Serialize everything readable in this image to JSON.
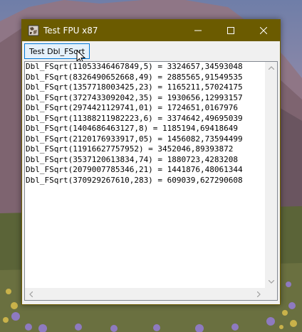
{
  "window": {
    "title": "Test FPU x87"
  },
  "toolbar": {
    "test_button_label": "Test Dbl_FSqrt"
  },
  "output": {
    "lines": [
      "Dbl_FSqrt(11053346467849,5) = 3324657,34593048",
      "Dbl_FSqrt(8326490652668,49) = 2885565,91549535",
      "Dbl_FSqrt(1357718003425,23) = 1165211,57024175",
      "Dbl_FSqrt(3727433092042,35) = 1930656,12993157",
      "Dbl_FSqrt(2974421129741,01) = 1724651,0167976",
      "Dbl_FSqrt(11388211982223,6) = 3374642,49695039",
      "Dbl_FSqrt(1404686463127,8) = 1185194,69418649",
      "Dbl_FSqrt(2120176933917,05) = 1456082,73594499",
      "Dbl_FSqrt(11916627757952) = 3452046,89393872",
      "Dbl_FSqrt(3537120613834,74) = 1880723,4283208",
      "Dbl_FSqrt(2079007785346,21) = 1441876,48061344",
      "Dbl_FSqrt(370929267610,283) = 609039,627290608"
    ]
  },
  "colors": {
    "titlebar": "#6b5b00",
    "button_border": "#0078d7",
    "button_fill": "#e5f1fb"
  },
  "icons": {
    "app": "app-icon",
    "minimize": "minimize-icon",
    "maximize": "maximize-icon",
    "close": "close-icon",
    "cursor": "mouse-pointer-icon"
  }
}
